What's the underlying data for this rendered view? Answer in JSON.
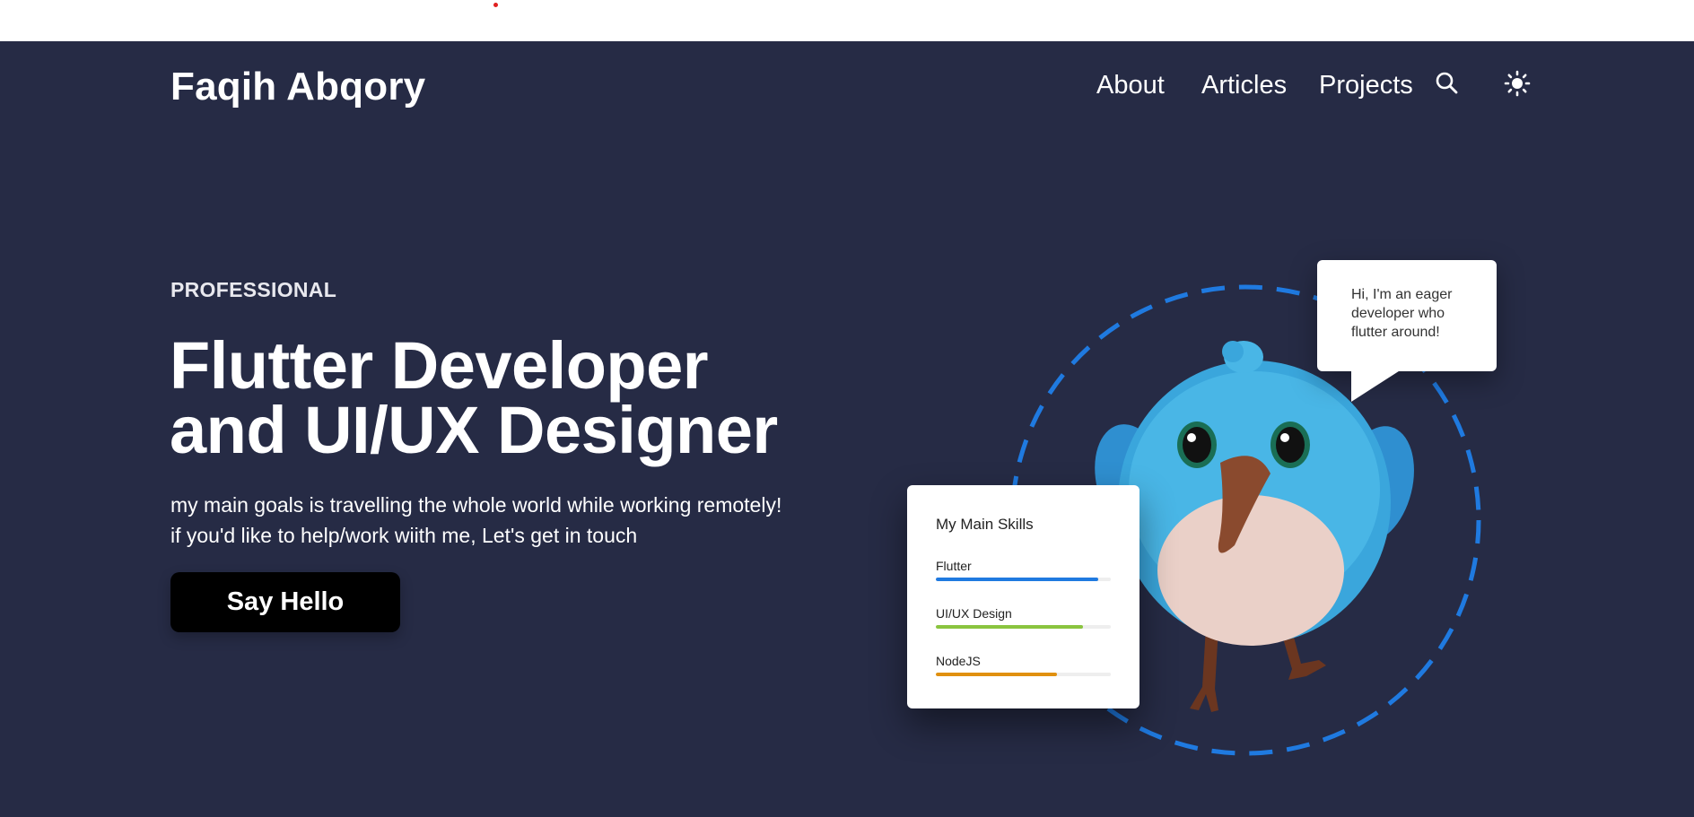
{
  "header": {
    "brand": "Faqih Abqory",
    "nav": [
      {
        "label": "About"
      },
      {
        "label": "Articles"
      },
      {
        "label": "Projects"
      }
    ],
    "search_icon": "search-icon",
    "theme_icon": "sun-icon"
  },
  "hero": {
    "eyebrow": "PROFESSIONAL",
    "headline_line1": "Flutter Developer",
    "headline_line2": "and UI/UX Designer",
    "desc_line1": "my main goals is travelling the whole world while working remotely!",
    "desc_line2": "if you'd like to help/work wiith me, Let's get in touch",
    "cta_label": "Say Hello"
  },
  "illustration": {
    "bubble_text": "Hi, I'm an eager developer who flutter around!",
    "mascot": "plush-bird-mascot",
    "skills_title": "My Main Skills",
    "skills": [
      {
        "name": "Flutter",
        "level": 0.93,
        "color": "#1f7ae0"
      },
      {
        "name": "UI/UX Design",
        "level": 0.84,
        "color": "#8ac43f"
      },
      {
        "name": "NodeJS",
        "level": 0.69,
        "color": "#e0900f"
      }
    ]
  },
  "colors": {
    "background": "#262b45",
    "ring": "#1f7ae0",
    "cta_bg": "#000000"
  }
}
